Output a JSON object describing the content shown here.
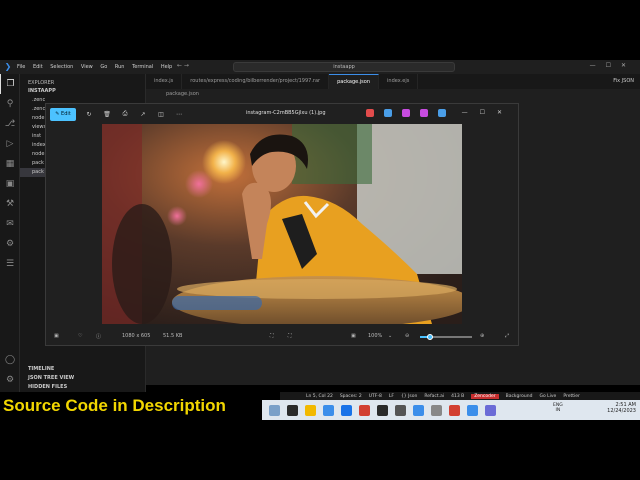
{
  "vscode": {
    "menu": [
      "File",
      "Edit",
      "Selection",
      "View",
      "Go",
      "Run",
      "Terminal",
      "Help"
    ],
    "command_center": "instaapp",
    "explorer": {
      "header": "EXPLORER",
      "project": "INSTAAPP",
      "items": [
        ".zenc",
        ".zenc",
        "node",
        "views",
        "inst",
        "index",
        "node",
        "pack",
        "pack"
      ],
      "selected_index": 8,
      "sections": [
        "TIMELINE",
        "JSON TREE VIEW",
        "HIDDEN FILES"
      ]
    },
    "tabs": [
      {
        "label": "index.js",
        "active": false
      },
      {
        "label": "routes/express/coding/bilberrender/project/1997.rar",
        "active": false
      },
      {
        "label": "package.json",
        "active": true
      },
      {
        "label": "index.ejs",
        "active": false
      }
    ],
    "tabs_right": "Fix JSON",
    "breadcrumb": "package.json"
  },
  "statusbar": {
    "items": [
      "Ln 5, Col 22",
      "Spaces: 2",
      "UTF-8",
      "LF",
      "{} Json",
      "Refact.ai",
      "413 B"
    ],
    "zencoder": "Zencoder",
    "right_items": [
      "Background",
      "Go Live",
      "Prettier"
    ]
  },
  "taskbar": {
    "language": [
      "ENG",
      "IN"
    ],
    "time": "2:51 AM",
    "date": "12/24/2023",
    "colors": [
      "#7aa0c8",
      "#2b2b2b",
      "#f2b900",
      "#3b8eea",
      "#1a73e8",
      "#d23f31",
      "#2b2b2b",
      "#555555",
      "#3b8eea",
      "#888888",
      "#d23f31",
      "#3b8eea",
      "#6b6bd6"
    ]
  },
  "banner": "Source Code in  Description",
  "viewer": {
    "edit_label": "Edit",
    "filename": "instagram-C2mBB5Gjlxu (1).jpg",
    "dimensions": "1080 x 605",
    "filesize": "51.5 KB",
    "zoom": "100%",
    "zoom_level": 0.2,
    "app_icon_colors": [
      "#e24c4c",
      "#4a9ee8",
      "#c84ce0",
      "#c84ce0",
      "#4a9ee8"
    ]
  }
}
